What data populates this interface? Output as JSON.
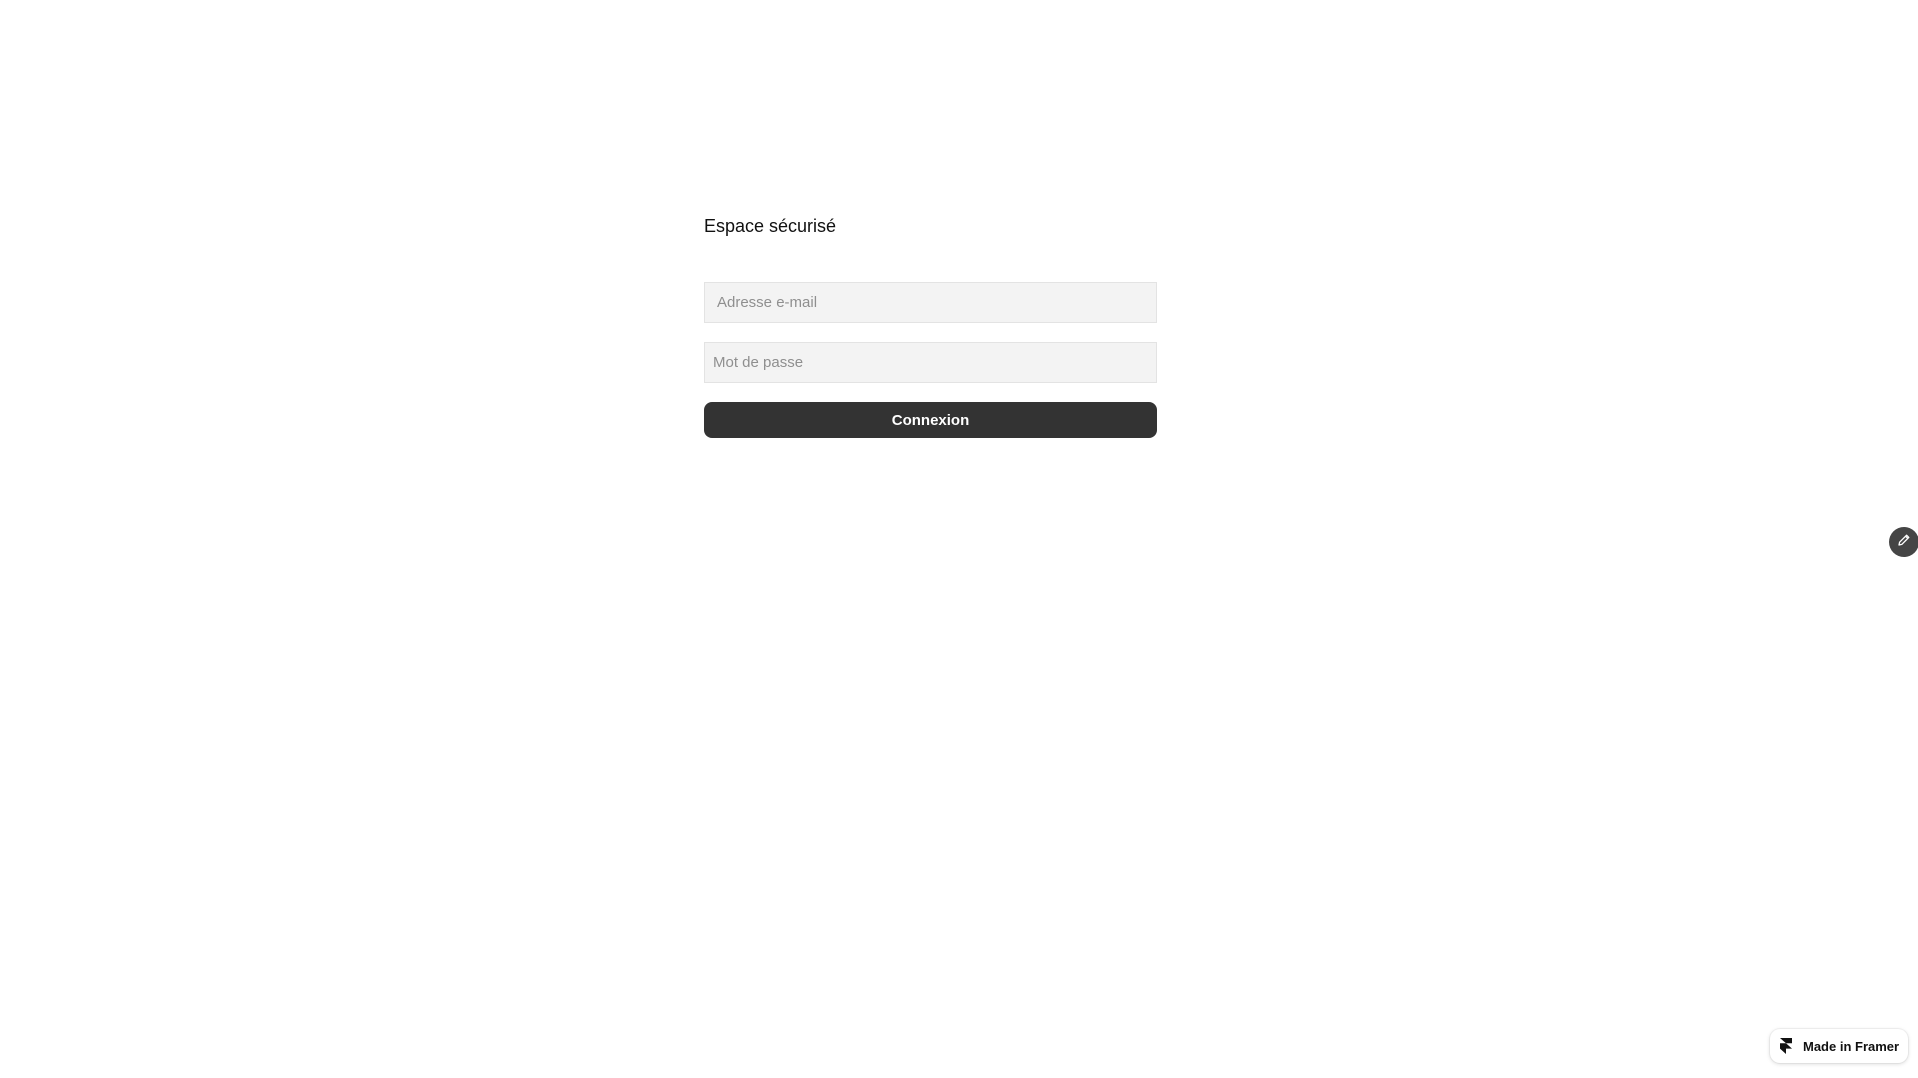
{
  "page": {
    "title": "Espace sécurisé"
  },
  "form": {
    "email_placeholder": "Adresse e-mail",
    "password_placeholder": "Mot de passe",
    "submit_label": "Connexion"
  },
  "edit_button": {
    "icon": "pencil-icon"
  },
  "framer_badge": {
    "label": "Made in Framer",
    "icon": "framer-logo-icon"
  },
  "colors": {
    "button": "#333333",
    "field_background": "#f3f3f3",
    "fab": "#454545"
  }
}
